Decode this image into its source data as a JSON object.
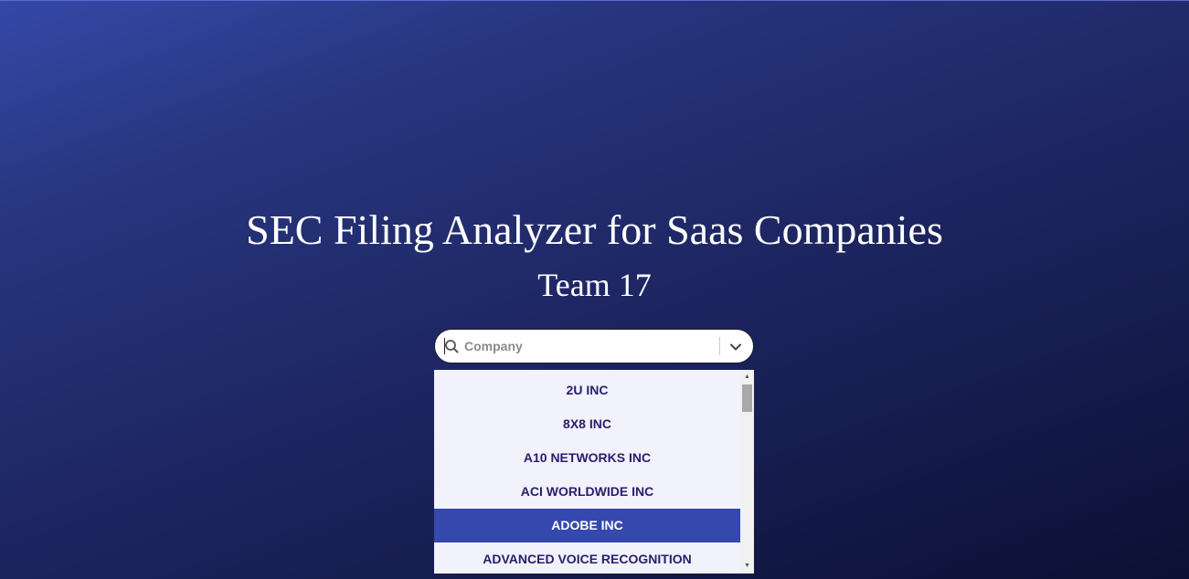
{
  "header": {
    "title": "SEC Filing Analyzer for Saas Companies",
    "subtitle": "Team 17"
  },
  "company_select": {
    "placeholder": "Company",
    "value": "",
    "icons": {
      "search": "search-icon",
      "dropdown": "chevron-down-icon"
    },
    "options": [
      "2U INC",
      "8X8 INC",
      "A10 NETWORKS INC",
      "ACI WORLDWIDE INC",
      "ADOBE INC",
      "ADVANCED VOICE RECOGNITION"
    ],
    "highlighted_option": "ADOBE INC"
  },
  "colors": {
    "background_start": "#3548a8",
    "background_end": "#0b1034",
    "menu_background": "#f1f2fc",
    "option_text": "#2b1d6b",
    "highlight": "#3548ad"
  }
}
